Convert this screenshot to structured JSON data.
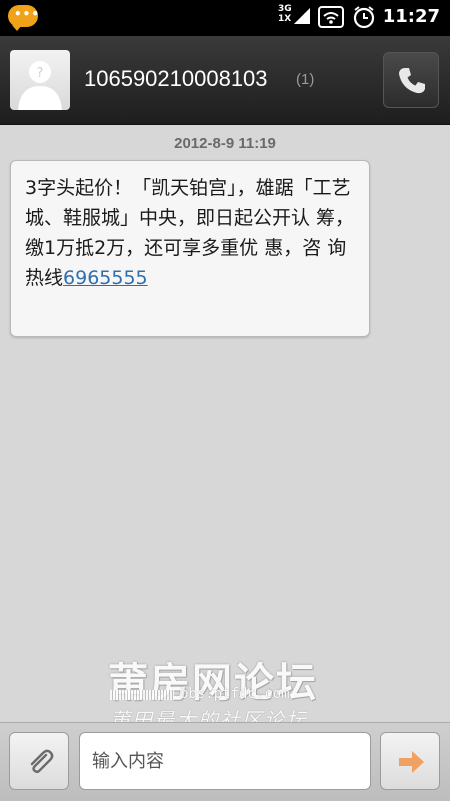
{
  "status_bar": {
    "network_top": "3G",
    "network_bottom": "1X",
    "time": "11:27",
    "app_icon": "chat-bubble-icon",
    "icons": [
      "signal-icon",
      "wifi-icon",
      "alarm-icon"
    ]
  },
  "header": {
    "contact_number": "106590210008103",
    "message_count": "(1)",
    "avatar_icon": "unknown-contact-avatar",
    "call_icon": "phone-icon"
  },
  "conversation": {
    "timestamp": "2012-8-9 11:19",
    "message": {
      "text": "3字头起价！「凯天铂宫」，雄踞「工艺城、鞋服城」中央，即日起公开认 筹，缴1万抵2万，还可享多重优 惠，咨 询热线",
      "phone_link": "6965555"
    }
  },
  "watermark": {
    "title": "莆房网论坛",
    "url": "bbs.ptfdc.com",
    "slogan": "莆田最大的社区论坛"
  },
  "composer": {
    "attach_icon": "paperclip-icon",
    "input_placeholder": "输入内容",
    "send_icon": "arrow-right-icon"
  },
  "colors": {
    "background": "#d7d7d7",
    "header": "#2a2a2a",
    "link": "#2f6fae",
    "send_arrow": "#f0a060",
    "app_icon": "#f0a21b"
  }
}
